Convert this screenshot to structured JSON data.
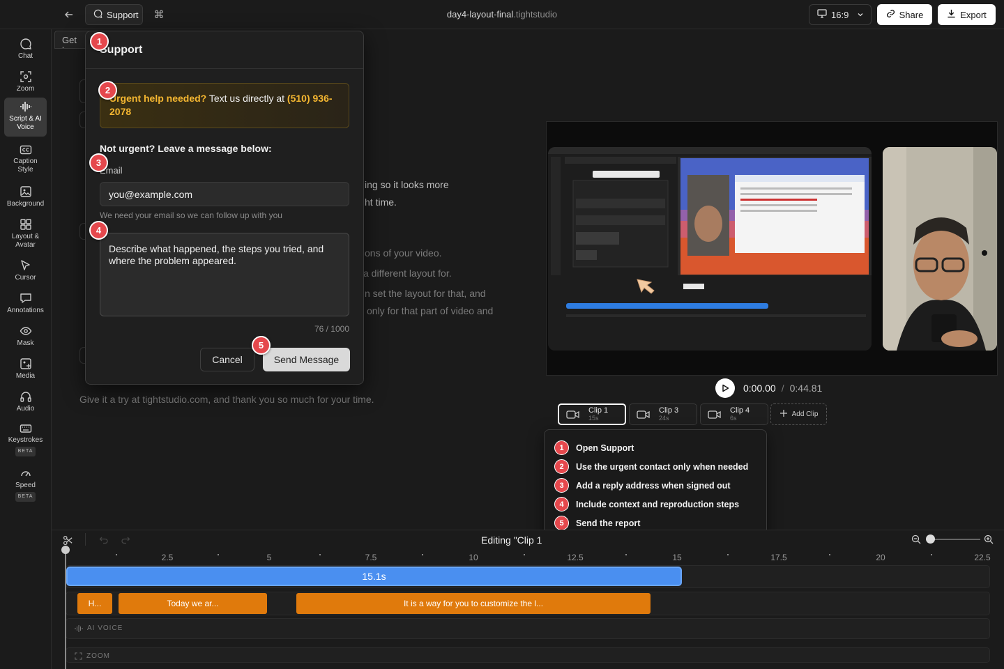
{
  "header": {
    "support_label": "Support",
    "title_name": "day4-layout-final",
    "title_ext": ".tightstudio",
    "ratio": "16:9",
    "share_label": "Share",
    "export_label": "Export"
  },
  "sidebar": {
    "items": [
      {
        "label": "Chat"
      },
      {
        "label": "Zoom"
      },
      {
        "label": "Script & AI Voice"
      },
      {
        "label": "Caption Style"
      },
      {
        "label": "Background"
      },
      {
        "label": "Layout & Avatar"
      },
      {
        "label": "Cursor"
      },
      {
        "label": "Annotations"
      },
      {
        "label": "Mask"
      },
      {
        "label": "Media"
      },
      {
        "label": "Audio"
      },
      {
        "label": "Keystrokes",
        "badge": "BETA"
      },
      {
        "label": "Speed",
        "badge": "BETA"
      }
    ]
  },
  "document": {
    "ghost_tab": "Get he",
    "fragments": {
      "f1": "ing so it looks more",
      "f2": "ht time.",
      "f3": "ons of your video.",
      "f4": "a different layout for.",
      "f5": "n set the layout for that, and",
      "f6": "only for that part of video and"
    },
    "closing": "Give it a try at tightstudio.com, and thank you so much for your time."
  },
  "support_modal": {
    "title": "Support",
    "urgent_bold": "Urgent help needed?",
    "urgent_text": " Text us directly at ",
    "urgent_phone": "(510) 936-2078",
    "not_urgent": "Not urgent? Leave a message below:",
    "email_label": "Email",
    "email_value": "you@example.com",
    "email_help": "We need your email so we can follow up with you",
    "message_placeholder": "Describe what happened, the steps you tried, and where the problem appeared.",
    "counter": "76 / 1000",
    "cancel_label": "Cancel",
    "send_label": "Send Message"
  },
  "markers": [
    "1",
    "2",
    "3",
    "4",
    "5"
  ],
  "player": {
    "current_time": "0:00.00",
    "separator": "/",
    "total_time": "0:44.81"
  },
  "clips": [
    {
      "name": "Clip 1",
      "length": "15s",
      "active": true
    },
    {
      "name": "Clip 3",
      "length": "24s",
      "active": false
    },
    {
      "name": "Clip 4",
      "length": "6s",
      "active": false
    }
  ],
  "add_clip_label": "Add Clip",
  "steps": [
    {
      "num": "1",
      "text": "Open Support"
    },
    {
      "num": "2",
      "text": "Use the urgent contact only when needed"
    },
    {
      "num": "3",
      "text": "Add a reply address when signed out"
    },
    {
      "num": "4",
      "text": "Include context and reproduction steps"
    },
    {
      "num": "5",
      "text": "Send the report"
    }
  ],
  "timeline": {
    "editing_label": "Editing \"Clip 1",
    "ruler": [
      "2.5",
      "5",
      "7.5",
      "10",
      "12.5",
      "15",
      "17.5",
      "20",
      "22.5"
    ],
    "video_segment": "15.1s",
    "caption_segments": [
      "H...",
      "Today we ar...",
      "It is a way for you to customize the l..."
    ],
    "ai_voice_label": "AI VOICE",
    "zoom_label": "ZOOM"
  },
  "colors": {
    "accent_blue": "#4a8ff0",
    "caption_orange": "#e07a0c",
    "marker_red": "#e5484d",
    "urgent_yellow": "#f5b731"
  }
}
